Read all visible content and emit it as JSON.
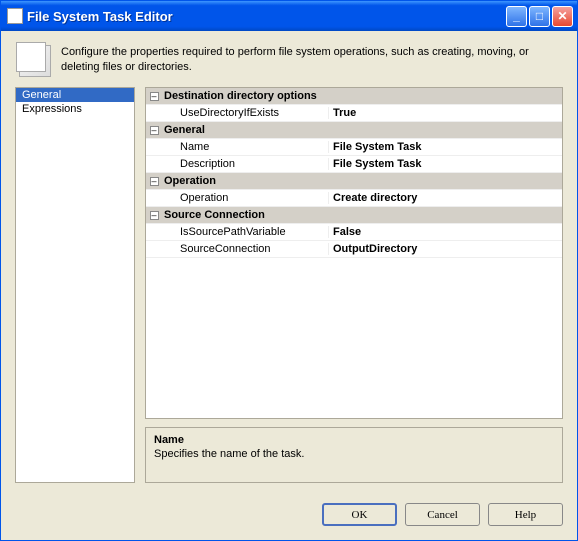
{
  "window": {
    "title": "File System Task Editor"
  },
  "header": {
    "text": "Configure the properties required to perform file system operations, such as creating, moving, or deleting files or directories."
  },
  "sidebar": {
    "items": [
      {
        "label": "General",
        "selected": true
      },
      {
        "label": "Expressions",
        "selected": false
      }
    ]
  },
  "grid": {
    "groups": [
      {
        "title": "Destination directory options",
        "props": [
          {
            "name": "UseDirectoryIfExists",
            "value": "True",
            "bold": true
          }
        ]
      },
      {
        "title": "General",
        "props": [
          {
            "name": "Name",
            "value": "File System Task",
            "bold": true
          },
          {
            "name": "Description",
            "value": "File System Task",
            "bold": true
          }
        ]
      },
      {
        "title": "Operation",
        "props": [
          {
            "name": "Operation",
            "value": "Create directory",
            "bold": true
          }
        ]
      },
      {
        "title": "Source Connection",
        "props": [
          {
            "name": "IsSourcePathVariable",
            "value": "False",
            "bold": true
          },
          {
            "name": "SourceConnection",
            "value": "OutputDirectory",
            "bold": true
          }
        ]
      }
    ]
  },
  "help": {
    "name": "Name",
    "description": "Specifies the name of the task."
  },
  "footer": {
    "ok": "OK",
    "cancel": "Cancel",
    "help": "Help"
  },
  "icons": {
    "expander": "–"
  }
}
